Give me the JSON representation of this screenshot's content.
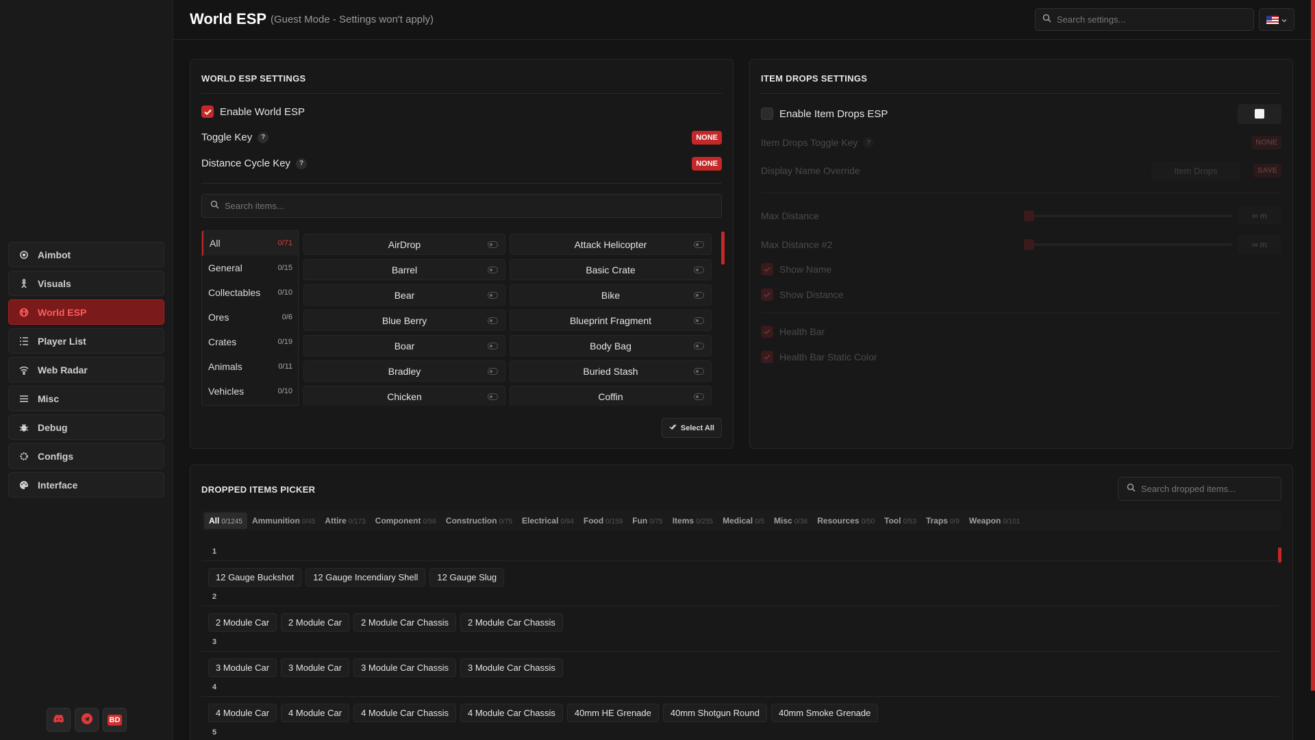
{
  "header": {
    "title": "World ESP",
    "subtitle": "(Guest Mode - Settings won't apply)",
    "search_placeholder": "Search settings..."
  },
  "sidebar": {
    "items": [
      {
        "label": "Aimbot",
        "icon": "crosshair-icon"
      },
      {
        "label": "Visuals",
        "icon": "person-icon"
      },
      {
        "label": "World ESP",
        "icon": "globe-icon",
        "active": true
      },
      {
        "label": "Player List",
        "icon": "list-icon"
      },
      {
        "label": "Web Radar",
        "icon": "wifi-icon"
      },
      {
        "label": "Misc",
        "icon": "menu-icon"
      },
      {
        "label": "Debug",
        "icon": "bug-icon"
      },
      {
        "label": "Configs",
        "icon": "gear-icon"
      },
      {
        "label": "Interface",
        "icon": "palette-icon"
      }
    ],
    "social": {
      "bd_label": "BD"
    }
  },
  "world_esp": {
    "title": "WORLD ESP SETTINGS",
    "enable_label": "Enable World ESP",
    "toggle_key_label": "Toggle Key",
    "toggle_key_value": "NONE",
    "distance_key_label": "Distance Cycle Key",
    "distance_key_value": "NONE",
    "help": "?",
    "search_placeholder": "Search items...",
    "categories": [
      {
        "label": "All",
        "count": "0/71"
      },
      {
        "label": "General",
        "count": "0/15"
      },
      {
        "label": "Collectables",
        "count": "0/10"
      },
      {
        "label": "Ores",
        "count": "0/6"
      },
      {
        "label": "Crates",
        "count": "0/19"
      },
      {
        "label": "Animals",
        "count": "0/11"
      },
      {
        "label": "Vehicles",
        "count": "0/10"
      }
    ],
    "items": [
      "AirDrop",
      "Attack Helicopter",
      "Barrel",
      "Basic Crate",
      "Bear",
      "Bike",
      "Blue Berry",
      "Blueprint Fragment",
      "Boar",
      "Body Bag",
      "Bradley",
      "Buried Stash",
      "Chicken",
      "Coffin"
    ],
    "select_all_label": "Select All"
  },
  "item_drops": {
    "title": "ITEM DROPS SETTINGS",
    "enable_label": "Enable Item Drops ESP",
    "toggle_key_label": "Item Drops Toggle Key",
    "toggle_key_value": "NONE",
    "display_name_label": "Display Name Override",
    "display_name_value": "Item Drops",
    "save_label": "SAVE",
    "max_distance_label": "Max Distance",
    "max_distance_value": "∞ m",
    "max_distance2_label": "Max Distance #2",
    "max_distance2_value": "∞ m",
    "show_name_label": "Show Name",
    "show_distance_label": "Show Distance",
    "health_bar_label": "Health Bar",
    "health_bar_static_label": "Health Bar Static Color"
  },
  "dropped": {
    "title": "DROPPED ITEMS PICKER",
    "search_placeholder": "Search dropped items...",
    "tabs": [
      {
        "label": "All",
        "count": "0/1245"
      },
      {
        "label": "Ammunition",
        "count": "0/45"
      },
      {
        "label": "Attire",
        "count": "0/173"
      },
      {
        "label": "Component",
        "count": "0/56"
      },
      {
        "label": "Construction",
        "count": "0/75"
      },
      {
        "label": "Electrical",
        "count": "0/94"
      },
      {
        "label": "Food",
        "count": "0/159"
      },
      {
        "label": "Fun",
        "count": "0/75"
      },
      {
        "label": "Items",
        "count": "0/255"
      },
      {
        "label": "Medical",
        "count": "0/5"
      },
      {
        "label": "Misc",
        "count": "0/36"
      },
      {
        "label": "Resources",
        "count": "0/50"
      },
      {
        "label": "Tool",
        "count": "0/53"
      },
      {
        "label": "Traps",
        "count": "0/9"
      },
      {
        "label": "Weapon",
        "count": "0/101"
      }
    ],
    "groups": [
      {
        "head": "1",
        "items": [
          "12 Gauge Buckshot",
          "12 Gauge Incendiary Shell",
          "12 Gauge Slug"
        ]
      },
      {
        "head": "2",
        "items": [
          "2 Module Car",
          "2 Module Car",
          "2 Module Car Chassis",
          "2 Module Car Chassis"
        ]
      },
      {
        "head": "3",
        "items": [
          "3 Module Car",
          "3 Module Car",
          "3 Module Car Chassis",
          "3 Module Car Chassis"
        ]
      },
      {
        "head": "4",
        "items": [
          "4 Module Car",
          "4 Module Car",
          "4 Module Car Chassis",
          "4 Module Car Chassis",
          "40mm HE Grenade",
          "40mm Shotgun Round",
          "40mm Smoke Grenade"
        ]
      },
      {
        "head": "5",
        "items": []
      }
    ]
  }
}
